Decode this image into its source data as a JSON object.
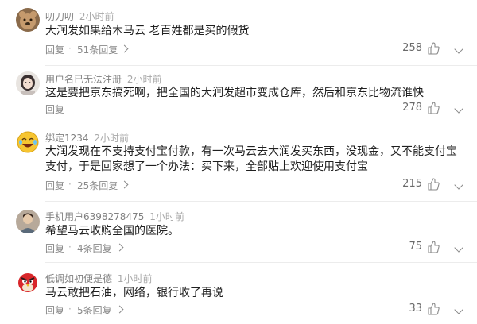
{
  "comments": [
    {
      "username": "叨刀叨",
      "time": "2小时前",
      "text": "大润发如果给木马云 老百姓都是买的假货",
      "reply_label": "回复",
      "reply_count": "51条回复",
      "likes": "258",
      "avatar": "bear-avatar-icon"
    },
    {
      "username": "用户名已无法注册",
      "time": "2小时前",
      "text": "这是要把京东搞死啊，把全国的大润发超市变成仓库，然后和京东比物流谁快",
      "reply_label": "回复",
      "reply_count": "",
      "likes": "278",
      "avatar": "girl-avatar-icon"
    },
    {
      "username": "绑定1234",
      "time": "2小时前",
      "text": "大润发现在不支持支付宝付款，有一次马云去大润发买东西，没现金，又不能支付宝支付，于是回家想了一个办法：买下来，全部贴上欢迎使用支付宝",
      "reply_label": "回复",
      "reply_count": "25条回复",
      "likes": "215",
      "avatar": "laughing-emoji-avatar-icon"
    },
    {
      "username": "手机用户6398278475",
      "time": "1小时前",
      "text": "希望马云收购全国的医院。",
      "reply_label": "回复",
      "reply_count": "4条回复",
      "likes": "75",
      "avatar": "person-photo-avatar-icon"
    },
    {
      "username": "低调如初便是德",
      "time": "1小时前",
      "text": "马云敢把石油，网络，银行收了再说",
      "reply_label": "回复",
      "reply_count": "5条回复",
      "likes": "33",
      "avatar": "angry-bird-avatar-icon"
    }
  ],
  "icons": {
    "like": "thumbs-up-icon",
    "more": "chevron-down-icon",
    "reply_arrow": "chevron-right-icon"
  },
  "colors": {
    "text": "#202020",
    "meta": "#9a9a9a",
    "divider": "#ececec"
  }
}
